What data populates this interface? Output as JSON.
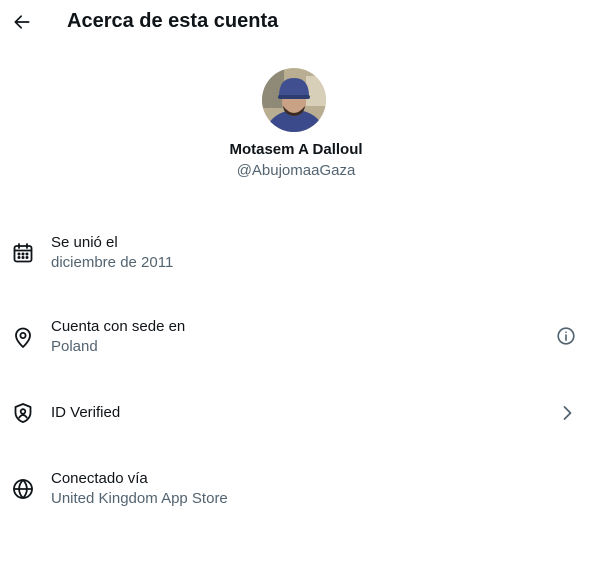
{
  "header": {
    "title": "Acerca de esta cuenta",
    "back_icon": "arrow-left-icon"
  },
  "profile": {
    "name": "Motasem A Dalloul",
    "handle": "@AbujomaaGaza"
  },
  "rows": [
    {
      "icon": "calendar-icon",
      "label": "Se unió el",
      "value": "diciembre de 2011"
    },
    {
      "icon": "location-pin-icon",
      "label": "Cuenta con sede en",
      "value": "Poland",
      "trailing_icon": "info-icon"
    },
    {
      "icon": "shield-icon",
      "label": "ID Verified",
      "trailing_icon": "chevron-right-icon"
    },
    {
      "icon": "globe-icon",
      "label": "Conectado vía",
      "value": "United Kingdom App Store"
    }
  ],
  "colors": {
    "text": "#0f1419",
    "secondary_text": "#536471",
    "background": "#ffffff"
  }
}
